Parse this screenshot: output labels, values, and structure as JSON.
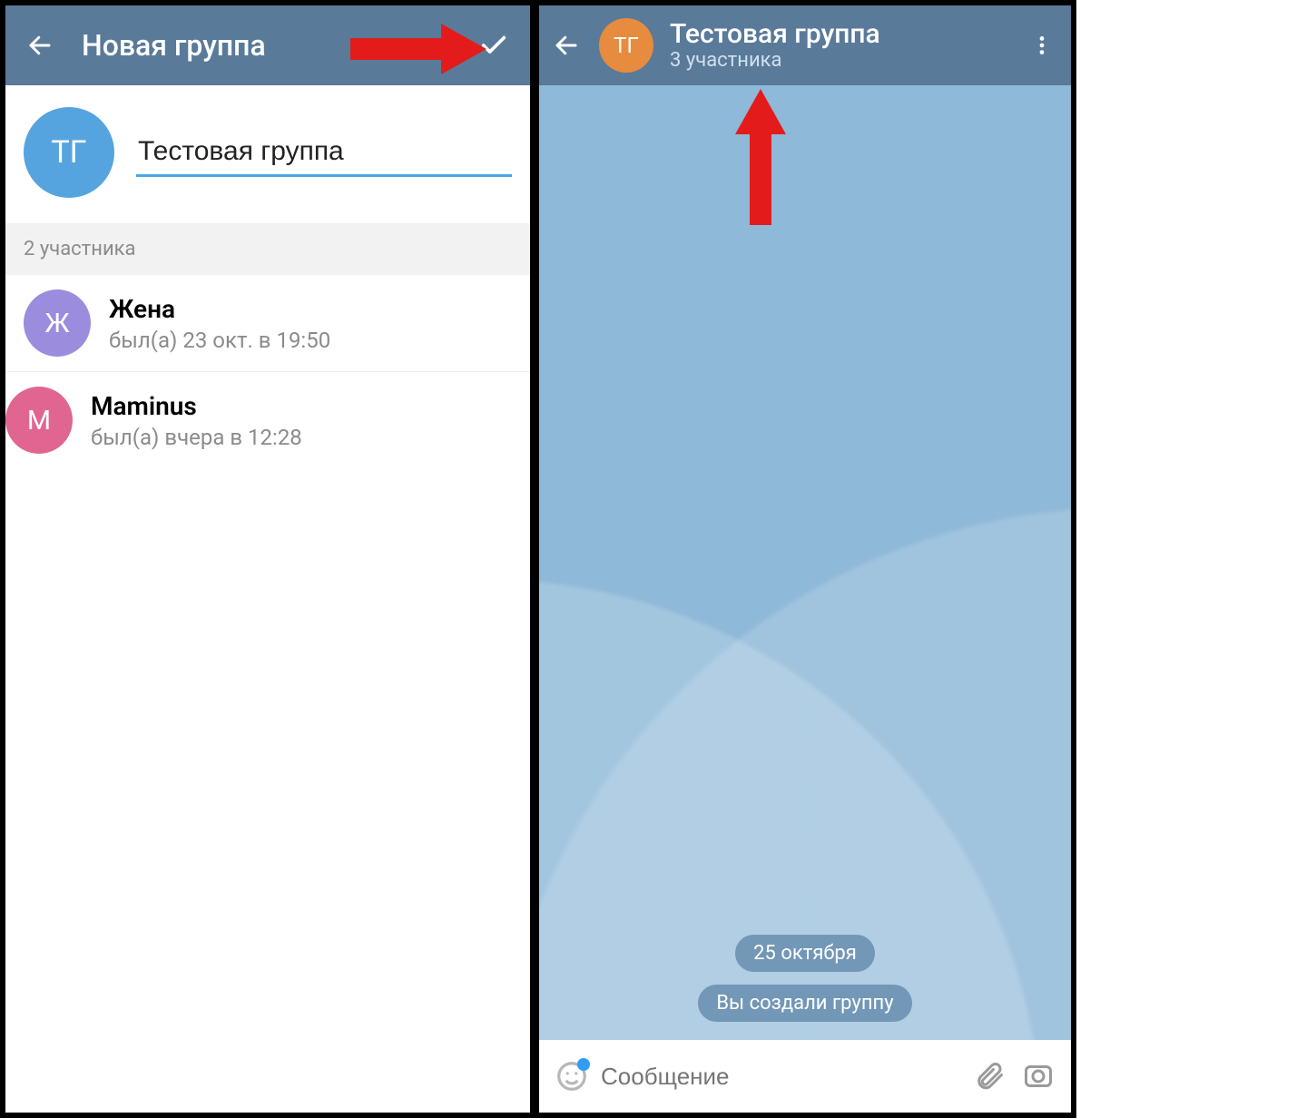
{
  "left": {
    "header_title": "Новая группа",
    "group_avatar_initials": "ТГ",
    "group_name_value": "Тестовая группа",
    "members_header": "2 участника",
    "members": [
      {
        "initial": "Ж",
        "avatar_color": "av-purple",
        "name": "Жена",
        "status": "был(а) 23 окт. в 19:50"
      },
      {
        "initial": "М",
        "avatar_color": "av-pink",
        "name": "Maminus",
        "status": "был(а) вчера в 12:28"
      }
    ]
  },
  "right": {
    "group_avatar_initials": "ТГ",
    "group_title": "Тестовая группа",
    "group_subtitle": "3 участника",
    "date_pill": "25 октября",
    "system_pill": "Вы создали группу",
    "input_placeholder": "Сообщение"
  }
}
